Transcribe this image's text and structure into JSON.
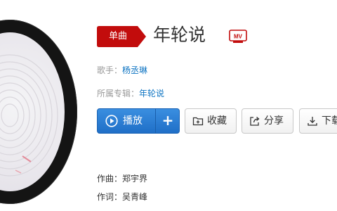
{
  "song": {
    "badge": "单曲",
    "title": "年轮说",
    "mv_label": "MV"
  },
  "meta": {
    "singer_label": "歌手：",
    "singer": "杨丞琳",
    "album_label": "所属专辑：",
    "album": "年轮说"
  },
  "actions": {
    "play_label": "播放",
    "add_label": "+",
    "favorite_label": "收藏",
    "share_label": "分享",
    "download_label": "下载"
  },
  "credits": {
    "composer": "作曲：郑宇界",
    "lyricist": "作词：吴青峰"
  },
  "colors": {
    "badge_red": "#c20c0c",
    "link_blue": "#0c73c2",
    "play_blue": "#2a7fd6"
  },
  "icons": {
    "play": "play-circle-icon",
    "favorite": "folder-plus-icon",
    "share": "share-arrow-icon",
    "download": "download-icon",
    "mv": "mv-icon"
  }
}
